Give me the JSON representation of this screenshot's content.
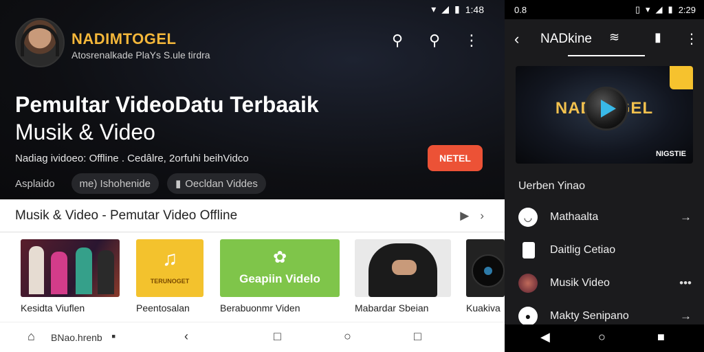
{
  "left": {
    "status_time": "1:48",
    "brand": "NADIMTOGEL",
    "brand_sub": "Atosrenalkade PlaYs S.ule tirdra",
    "title_line1": "Pemultar VideoDatu Terbaaik",
    "title_line2": "Musik & Video",
    "tagline": "Nadiag ividoeo: Offline . Cedâlre, 2orfuhi beihVidco",
    "next_button": "NETEL",
    "chips": [
      "Asplaido",
      "me) Ishohenide",
      "Oecldan Viddes"
    ],
    "section_title": "Musik & Video - Pemutar Video Offline",
    "cards": [
      {
        "label": "Kesidta Viuflen",
        "thumb_text": ""
      },
      {
        "label": "Peentosalan",
        "thumb_text": "TERUNOGET"
      },
      {
        "label": "Berabuonmr Viden",
        "thumb_text": "Geapiin Videlo"
      },
      {
        "label": "Mabardar Sbeian",
        "thumb_text": ""
      },
      {
        "label": "Kuakiva",
        "thumb_text": ""
      }
    ],
    "bottom_nav_label": "BNao.hrenb"
  },
  "right": {
    "status_left": "0.8",
    "status_time": "2:29",
    "title": "NADkine",
    "feature_logo": "NADTOGEL",
    "feature_caption": "NIGSTIE",
    "section_label": "Uerben Yinao",
    "list": [
      {
        "label": "Mathaalta",
        "action": "→"
      },
      {
        "label": "Daitlig Cetiao",
        "action": ""
      },
      {
        "label": "Musik Video",
        "action": "•••"
      },
      {
        "label": "Makty Senipano",
        "action": "→"
      }
    ]
  },
  "colors": {
    "accent": "#ec5236",
    "brand": "#f4b73a",
    "feature_play": "#39b9e8"
  }
}
